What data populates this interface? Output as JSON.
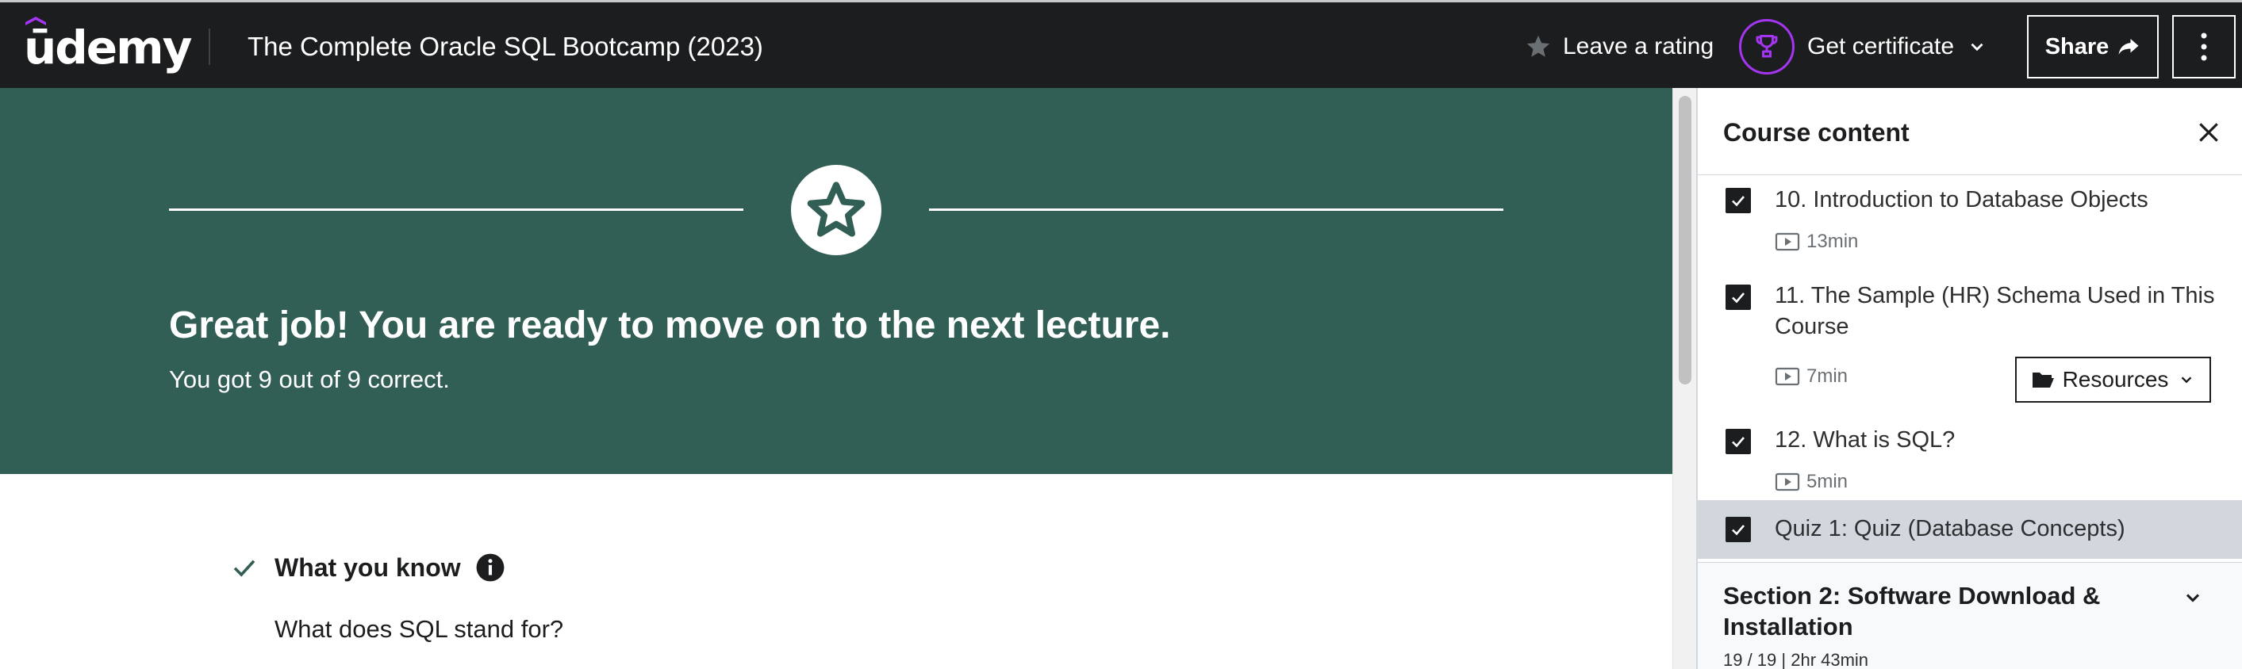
{
  "header": {
    "logo_text": "ūdemy",
    "course_title": "The Complete Oracle SQL Bootcamp (2023)",
    "rating_label": "Leave a rating",
    "certificate_label": "Get certificate",
    "share_label": "Share"
  },
  "hero": {
    "title": "Great job! You are ready to move on to the next lecture.",
    "subtitle": "You got 9 out of 9 correct."
  },
  "feedback": {
    "section_label": "What you know",
    "question": "What does SQL stand for?"
  },
  "sidebar": {
    "title": "Course content",
    "items": [
      {
        "title": "10. Introduction to Database Objects",
        "duration": "13min",
        "checked": true
      },
      {
        "title": "11. The Sample (HR) Schema Used in This Course",
        "duration": "7min",
        "checked": true,
        "resources_label": "Resources"
      },
      {
        "title": "12. What is SQL?",
        "duration": "5min",
        "checked": true
      },
      {
        "title": "Quiz 1: Quiz (Database Concepts)",
        "checked": true,
        "active": true
      }
    ],
    "section": {
      "title": "Section 2: Software Download & Installation",
      "meta": "19 / 19 | 2hr 43min"
    }
  },
  "colors": {
    "header_bg": "#1c1d1f",
    "hero_bg": "#325f55",
    "brand_purple": "#a435f0",
    "active_item_bg": "#d1d7dc"
  }
}
